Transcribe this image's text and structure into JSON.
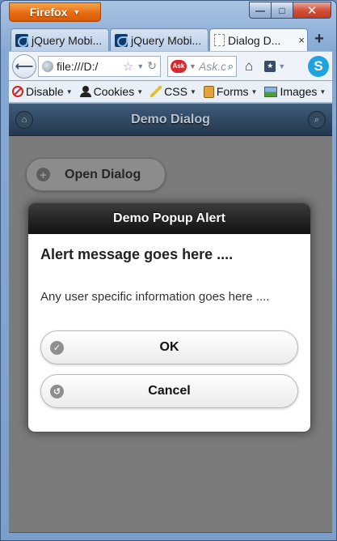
{
  "browser": {
    "app_button_label": "Firefox",
    "window_controls": {
      "minimize": "—",
      "maximize": "□",
      "close": "✕"
    },
    "tabs": [
      {
        "label": "jQuery Mobi...",
        "active": false
      },
      {
        "label": "jQuery Mobi...",
        "active": false
      },
      {
        "label": "Dialog D...",
        "active": true
      }
    ],
    "tab_close_glyph": "×",
    "new_tab_glyph": "+",
    "url": "file:///D:/",
    "search_placeholder": "Ask.c",
    "search_engine_logo": "Ask",
    "dev_toolbar": [
      {
        "label": "Disable",
        "icon": "disable-icon"
      },
      {
        "label": "Cookies",
        "icon": "cookie-icon"
      },
      {
        "label": "CSS",
        "icon": "css-icon"
      },
      {
        "label": "Forms",
        "icon": "forms-icon"
      },
      {
        "label": "Images",
        "icon": "images-icon"
      }
    ]
  },
  "page": {
    "header_title": "Demo Dialog",
    "open_dialog_label": "Open Dialog"
  },
  "dialog": {
    "title": "Demo Popup Alert",
    "heading": "Alert message goes here ....",
    "message": "Any user specific information goes here ....",
    "ok_label": "OK",
    "cancel_label": "Cancel"
  }
}
